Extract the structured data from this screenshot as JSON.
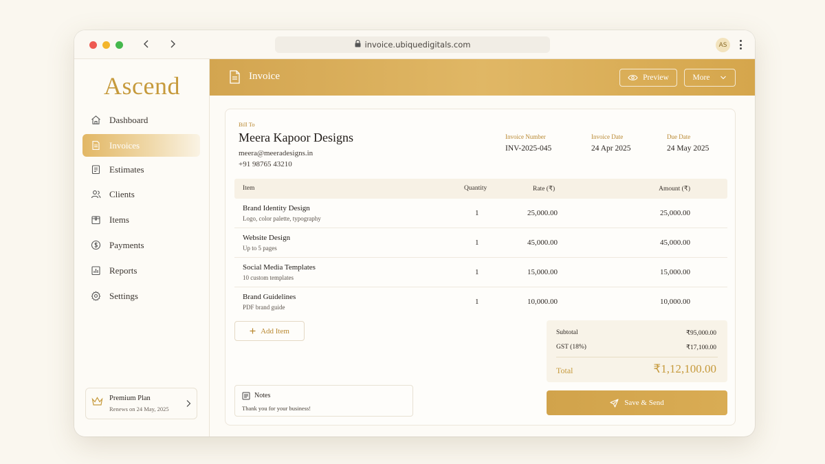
{
  "browser": {
    "url": "invoice.ubiquedigitals.com",
    "avatar_initials": "AS"
  },
  "sidebar": {
    "logo": "Ascend",
    "items": [
      {
        "label": "Dashboard",
        "icon": "home-icon"
      },
      {
        "label": "Invoices",
        "icon": "document-icon",
        "active": true
      },
      {
        "label": "Estimates",
        "icon": "clipboard-icon"
      },
      {
        "label": "Clients",
        "icon": "users-icon"
      },
      {
        "label": "Items",
        "icon": "box-icon"
      },
      {
        "label": "Payments",
        "icon": "dollar-icon"
      },
      {
        "label": "Reports",
        "icon": "chart-icon"
      },
      {
        "label": "Settings",
        "icon": "gear-icon"
      }
    ],
    "plan": {
      "title": "Premium Plan",
      "subtitle": "Renews on 24 May, 2025"
    }
  },
  "header": {
    "title": "Invoice",
    "preview_label": "Preview",
    "more_label": "More"
  },
  "invoice": {
    "bill_to_label": "Bill To",
    "client_name": "Meera Kapoor Designs",
    "client_email": "meera@meeradesigns.in",
    "client_phone": "+91 98765 43210",
    "meta": [
      {
        "label": "Invoice Number",
        "value": "INV-2025-045"
      },
      {
        "label": "Invoice Date",
        "value": "24 Apr 2025"
      },
      {
        "label": "Due Date",
        "value": "24 May 2025"
      }
    ],
    "columns": {
      "item": "Item",
      "quantity": "Quantity",
      "rate": "Rate (₹)",
      "amount": "Amount (₹)"
    },
    "rows": [
      {
        "name": "Brand Identity Design",
        "desc": "Logo, color palette, typography",
        "qty": "1",
        "rate": "25,000.00",
        "amount": "25,000.00"
      },
      {
        "name": "Website Design",
        "desc": "Up to 5 pages",
        "qty": "1",
        "rate": "45,000.00",
        "amount": "45,000.00"
      },
      {
        "name": "Social Media Templates",
        "desc": "10 custom templates",
        "qty": "1",
        "rate": "15,000.00",
        "amount": "15,000.00"
      },
      {
        "name": "Brand Guidelines",
        "desc": "PDF brand guide",
        "qty": "1",
        "rate": "10,000.00",
        "amount": "10,000.00"
      }
    ],
    "add_item_label": "Add Item",
    "totals": {
      "subtotal_label": "Subtotal",
      "subtotal_value": "₹95,000.00",
      "gst_label": "GST (18%)",
      "gst_value": "₹17,100.00",
      "total_label": "Total",
      "total_value": "₹1,12,100.00"
    },
    "notes": {
      "title": "Notes",
      "text": "Thank you for your business!"
    },
    "save_label": "Save & Send"
  },
  "colors": {
    "accent": "#D3A550",
    "accent_text": "#B8872F",
    "background": "#FAF7EF"
  }
}
